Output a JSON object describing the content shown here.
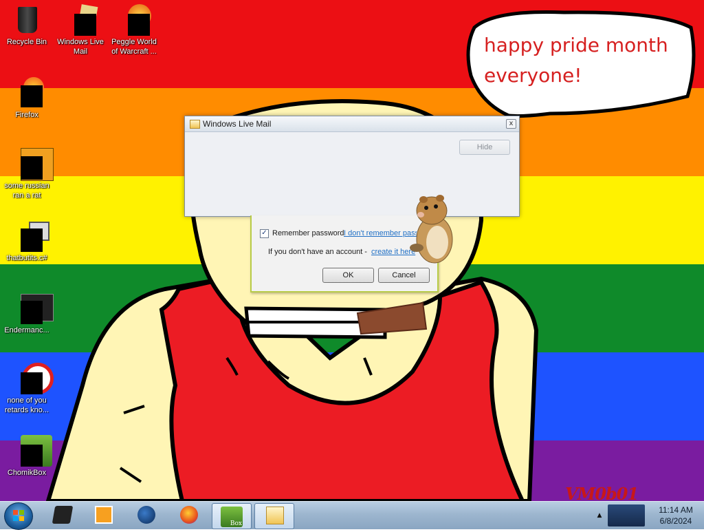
{
  "desktop": {
    "stripes": [
      {
        "color": "#ec0f14"
      },
      {
        "color": "#ff8c00"
      },
      {
        "color": "#fff200"
      },
      {
        "color": "#0f8a2a"
      },
      {
        "color": "#1e53ff"
      },
      {
        "color": "#7a1ca0"
      }
    ],
    "bubble_text_line1": "happy pride month",
    "bubble_text_line2": "everyone!",
    "watermark": "VM0b01"
  },
  "icons": {
    "recycle_bin": "Recycle Bin",
    "windows_live_mail": "Windows Live Mail",
    "peggle": "Peggle World of Warcraft ...",
    "firefox": "Firefox",
    "russian_rat": "some russian ran a rat",
    "thatbutits": "thatbutits.c#",
    "endermanc": "Endermanc...",
    "none_of_you": "none of you retards kno...",
    "chomikbox": "ChomikBox"
  },
  "wlm_window": {
    "title": "Windows Live Mail",
    "close_glyph": "x",
    "hide_label": "Hide"
  },
  "login_dialog": {
    "remember_label": "Remember password",
    "remember_checked": "✓",
    "forgot_link": "I don't remember password",
    "no_account_text": "If you don't have an account -",
    "create_link": "create it here",
    "ok_label": "OK",
    "cancel_label": "Cancel"
  },
  "taskbar": {
    "items": [
      {
        "name": "media-player"
      },
      {
        "name": "globe-app"
      },
      {
        "name": "firefox"
      },
      {
        "name": "chomikbox",
        "label": "Box"
      },
      {
        "name": "windows-live-mail"
      }
    ],
    "clock_time": "11:14 AM",
    "clock_date": "6/8/2024"
  }
}
